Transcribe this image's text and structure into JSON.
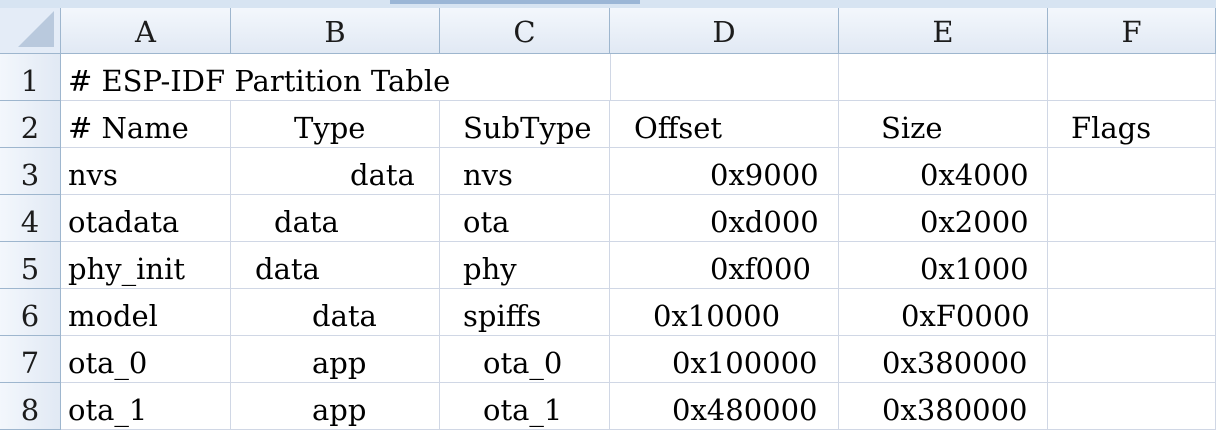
{
  "columns": [
    "A",
    "B",
    "C",
    "D",
    "E",
    "F"
  ],
  "rows": [
    "1",
    "2",
    "3",
    "4",
    "5",
    "6",
    "7",
    "8"
  ],
  "title": "# ESP-IDF Partition Table",
  "header": {
    "name": "# Name",
    "type": "Type",
    "subtype": "SubType",
    "offset": "Offset",
    "size": "Size",
    "flags": "Flags"
  },
  "partitions": [
    {
      "name": "nvs",
      "type": "data",
      "subtype": "nvs",
      "offset": "0x9000",
      "size": "0x4000"
    },
    {
      "name": "otadata",
      "type": "data",
      "subtype": "ota",
      "offset": "0xd000",
      "size": "0x2000"
    },
    {
      "name": "phy_init",
      "type": "data",
      "subtype": "phy",
      "offset": "0xf000",
      "size": "0x1000"
    },
    {
      "name": "model",
      "type": "data",
      "subtype": "spiffs",
      "offset": "0x10000",
      "size": "0xF0000"
    },
    {
      "name": "ota_0",
      "type": "app",
      "subtype": "ota_0",
      "offset": "0x100000",
      "size": "0x380000"
    },
    {
      "name": "ota_1",
      "type": "app",
      "subtype": "ota_1",
      "offset": "0x480000",
      "size": "0x380000"
    }
  ]
}
